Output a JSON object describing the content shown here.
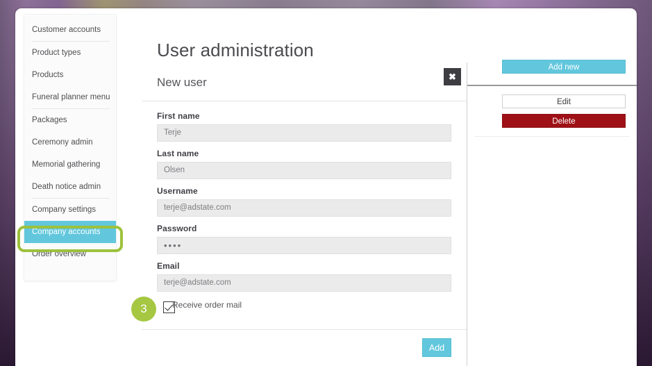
{
  "sidebar": {
    "items": [
      {
        "label": "Customer accounts",
        "active": false,
        "separator_after": true
      },
      {
        "label": "Product types",
        "active": false,
        "separator_after": false
      },
      {
        "label": "Products",
        "active": false,
        "separator_after": false
      },
      {
        "label": "Funeral planner menu",
        "active": false,
        "separator_after": true
      },
      {
        "label": "Packages",
        "active": false,
        "separator_after": false
      },
      {
        "label": "Ceremony admin",
        "active": false,
        "separator_after": false
      },
      {
        "label": "Memorial gathering",
        "active": false,
        "separator_after": false
      },
      {
        "label": "Death notice admin",
        "active": false,
        "separator_after": true
      },
      {
        "label": "Company settings",
        "active": false,
        "separator_after": false
      },
      {
        "label": "Company accounts",
        "active": true,
        "separator_after": false
      },
      {
        "label": "Order overview",
        "active": false,
        "separator_after": false
      }
    ]
  },
  "page": {
    "title": "User administration"
  },
  "modal": {
    "title": "New user",
    "close_icon": "close-icon",
    "close_glyph": "✖",
    "fields": [
      {
        "label": "First name",
        "value": "Terje",
        "type": "text"
      },
      {
        "label": "Last name",
        "value": "Olsen",
        "type": "text"
      },
      {
        "label": "Username",
        "value": "terje@adstate.com",
        "type": "text"
      },
      {
        "label": "Password",
        "value": "••••",
        "type": "password"
      },
      {
        "label": "Email",
        "value": "terje@adstate.com",
        "type": "text"
      }
    ],
    "checkbox": {
      "label": "Receive order mail",
      "checked": true
    },
    "step_badge": "3",
    "submit_label": "Add"
  },
  "right_panel": {
    "add_new_label": "Add new",
    "edit_label": "Edit",
    "delete_label": "Delete"
  },
  "colors": {
    "accent_cyan": "#62c7dd",
    "danger_red": "#9e1116",
    "annotation_green": "#9dc13c",
    "badge_green": "#a5c741",
    "dark_close": "#3d3d42"
  }
}
